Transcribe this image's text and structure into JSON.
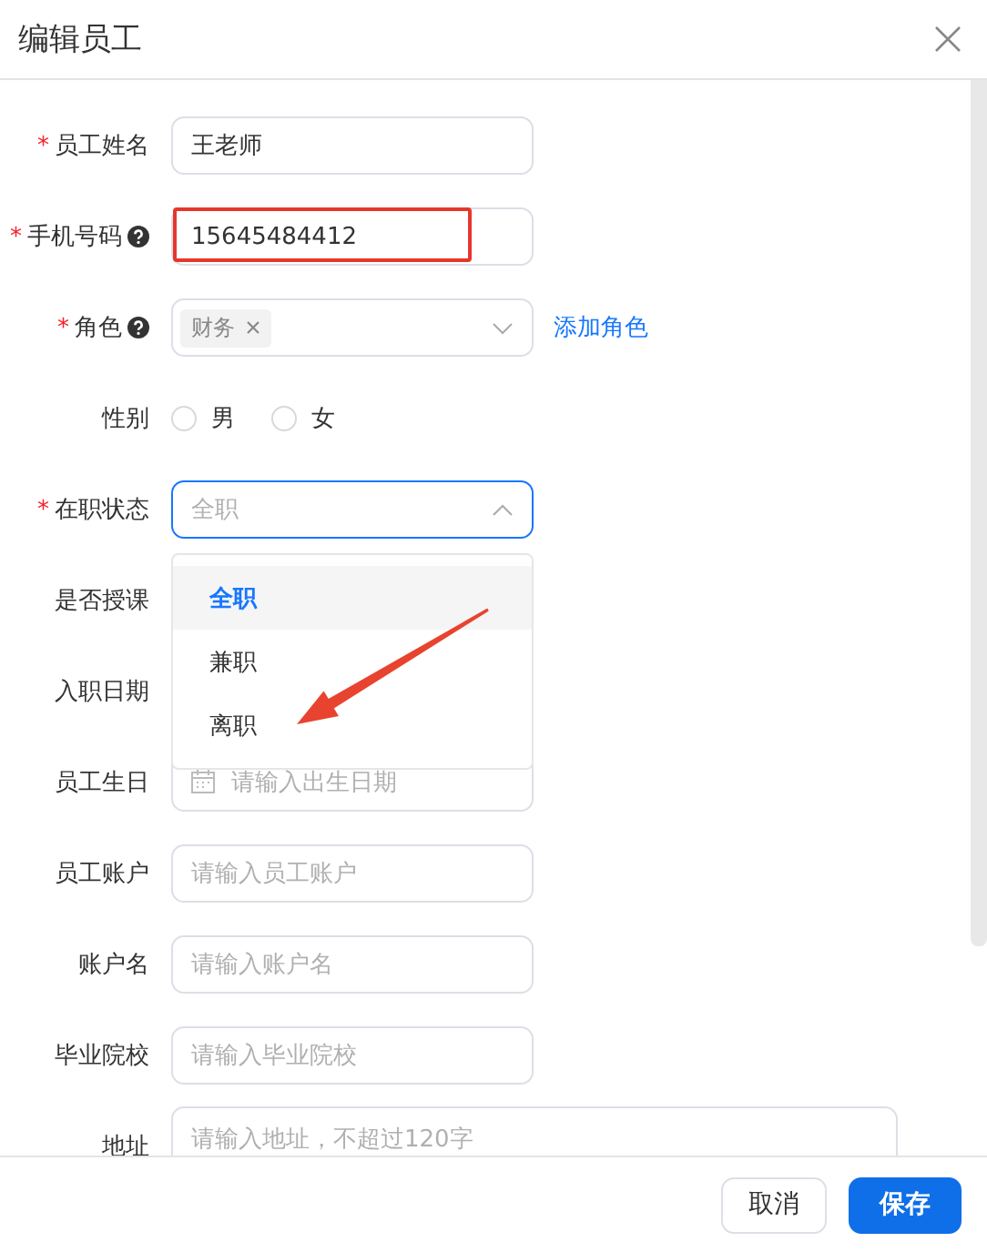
{
  "dialog": {
    "title": "编辑员工"
  },
  "rows": [
    {
      "label": "员工姓名",
      "required_mark": "*",
      "field": {
        "kind": "input",
        "value": "王老师"
      }
    },
    {
      "label": "手机号码",
      "required_mark": "*",
      "help": true,
      "field": {
        "kind": "input",
        "value": "15645484412",
        "highlighted": true
      }
    },
    {
      "label": "角色",
      "required_mark": "*",
      "help": true,
      "field": {
        "kind": "tags",
        "tags": [
          "财务"
        ],
        "open": false
      },
      "link": "添加角色"
    },
    {
      "label": "性别",
      "field": {
        "kind": "radio",
        "options": [
          {
            "label": "男",
            "selected": false
          },
          {
            "label": "女",
            "selected": false
          }
        ]
      }
    },
    {
      "label": "在职状态",
      "required_mark": "*",
      "field": {
        "kind": "select",
        "placeholder": "全职",
        "open": true,
        "options": [
          {
            "label": "全职",
            "selected": true
          },
          {
            "label": "兼职",
            "selected": false
          },
          {
            "label": "离职",
            "selected": false
          }
        ]
      }
    },
    {
      "label": "是否授课"
    },
    {
      "label": "入职日期"
    },
    {
      "label": "员工生日",
      "field": {
        "kind": "date",
        "placeholder": "请输入出生日期"
      }
    },
    {
      "label": "员工账户",
      "field": {
        "kind": "input",
        "placeholder": "请输入员工账户"
      }
    },
    {
      "label": "账户名",
      "field": {
        "kind": "input",
        "placeholder": "请输入账户名"
      }
    },
    {
      "label": "毕业院校",
      "field": {
        "kind": "input",
        "placeholder": "请输入毕业院校"
      }
    },
    {
      "label": "地址",
      "field": {
        "kind": "textarea",
        "placeholder": "请输入地址，不超过120字"
      }
    }
  ],
  "annotations": [
    {
      "kind": "arrow"
    }
  ],
  "buttons": [
    {
      "label": "取消",
      "kind": "default"
    },
    {
      "label": "保存",
      "kind": "primary"
    }
  ]
}
